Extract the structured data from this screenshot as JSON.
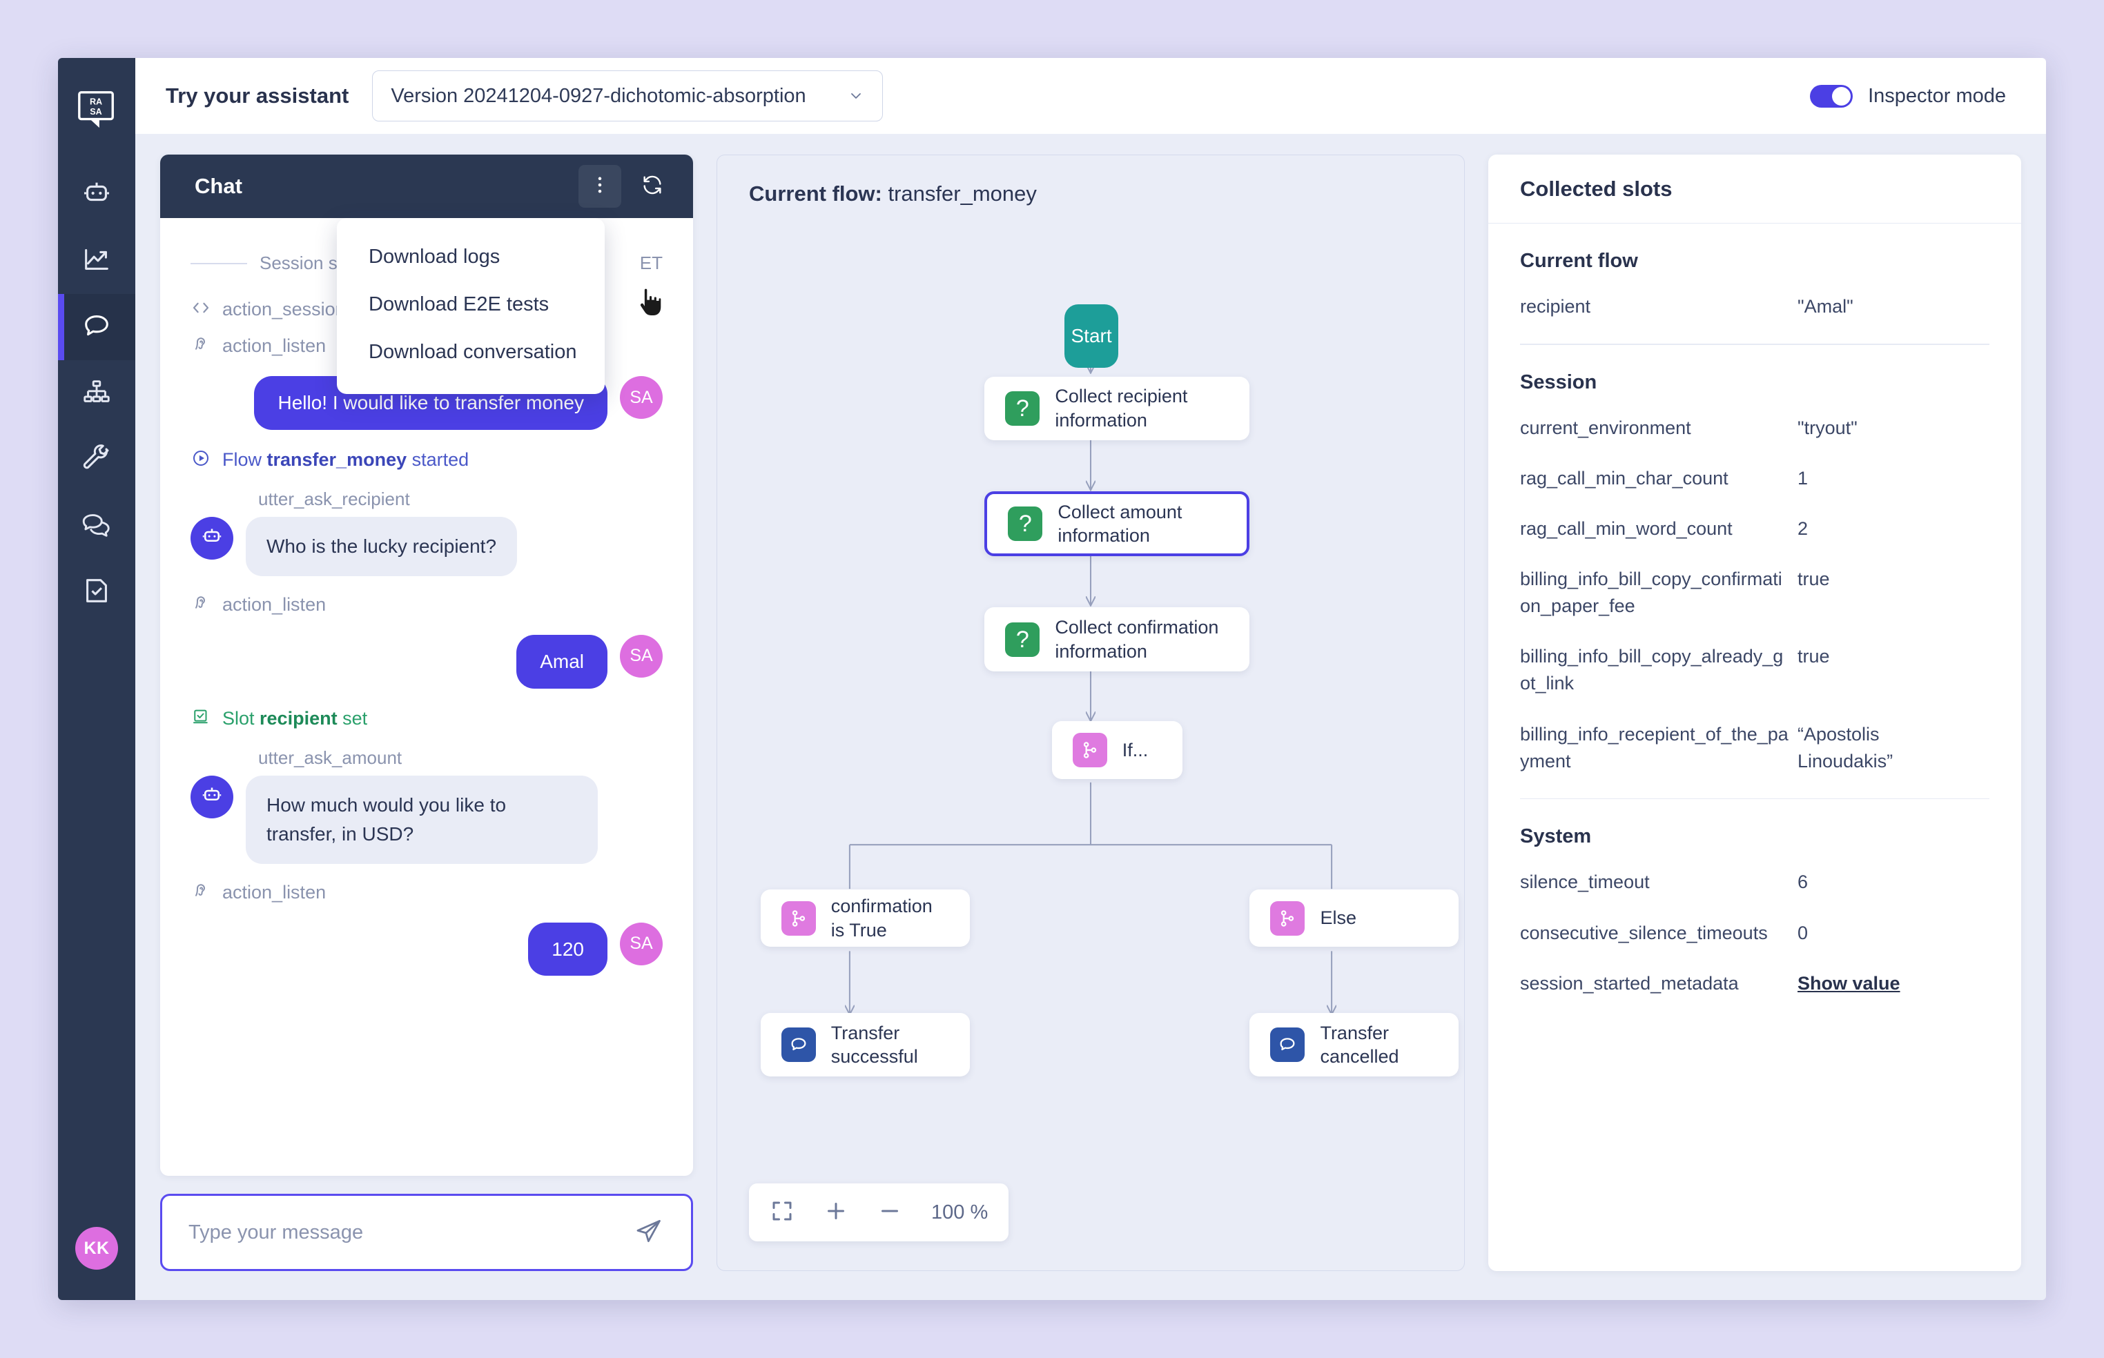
{
  "topbar": {
    "title": "Try your assistant",
    "version_value": "Version 20241204-0927-dichotomic-absorption",
    "inspector_label": "Inspector mode",
    "inspector_on": true,
    "accent": "#4b3fe4"
  },
  "sidebar": {
    "logo": "rasa-logo",
    "avatar_initials": "KK",
    "items": [
      {
        "name": "assistant",
        "icon": "robot-icon",
        "active": false
      },
      {
        "name": "analytics",
        "icon": "chart-line-icon",
        "active": false
      },
      {
        "name": "chat",
        "icon": "speech-bubble-icon",
        "active": true
      },
      {
        "name": "flows",
        "icon": "hierarchy-icon",
        "active": false
      },
      {
        "name": "tools",
        "icon": "wrench-icon",
        "active": false
      },
      {
        "name": "conversations",
        "icon": "double-bubble-icon",
        "active": false
      },
      {
        "name": "tests",
        "icon": "document-check-icon",
        "active": false
      }
    ]
  },
  "chat": {
    "title": "Chat",
    "menu": {
      "items": [
        "Download logs",
        "Download E2E tests",
        "Download conversation"
      ]
    },
    "session_divider": "Session star",
    "session_divider_tail": "ET",
    "events": {
      "action_session_start": "action_session",
      "action_listen": "action_listen",
      "flow_prefix": "Flow ",
      "flow_name": "transfer_money",
      "flow_suffix": " started",
      "slot_prefix": "Slot ",
      "slot_name": "recipient",
      "slot_suffix": " set"
    },
    "messages": {
      "user_hello": "Hello! I would like to transfer money",
      "utter_ask_recipient_label": "utter_ask_recipient",
      "bot_ask_recipient": "Who is the lucky recipient?",
      "user_recipient": "Amal",
      "utter_ask_amount_label": "utter_ask_amount",
      "bot_ask_amount": "How much would you like to transfer, in USD?",
      "user_amount": "120",
      "user_initials": "SA"
    },
    "composer_placeholder": "Type your message",
    "composer_value": ""
  },
  "flow": {
    "title_prefix": "Current flow: ",
    "title_name": "transfer_money",
    "zoom_value": "100 %",
    "nodes": {
      "start": "Start",
      "collect_recipient": "Collect recipient information",
      "collect_amount": "Collect amount information",
      "collect_confirmation": "Collect confirmation information",
      "if": "If...",
      "branch_true": "confirmation is True",
      "branch_else": "Else",
      "leaf_success": "Transfer successful",
      "leaf_cancelled": "Transfer cancelled"
    }
  },
  "slots": {
    "header": "Collected slots",
    "groups": [
      {
        "title": "Current flow",
        "rows": [
          {
            "key": "recipient",
            "value": "\"Amal\""
          }
        ]
      },
      {
        "title": "Session",
        "rows": [
          {
            "key": "current_environment",
            "value": "\"tryout\""
          },
          {
            "key": "rag_call_min_char_count",
            "value": "1"
          },
          {
            "key": "rag_call_min_word_count",
            "value": "2"
          },
          {
            "key": "billing_info_bill_copy_confirmation_paper_fee",
            "value": "true"
          },
          {
            "key": "billing_info_bill_copy_already_got_link",
            "value": "true"
          },
          {
            "key": "billing_info_recepient_of_the_payment",
            "value": "“Apostolis Linoudakis”"
          }
        ]
      },
      {
        "title": "System",
        "rows": [
          {
            "key": "silence_timeout",
            "value": "6"
          },
          {
            "key": "consecutive_silence_timeouts",
            "value": "0"
          },
          {
            "key": "session_started_metadata",
            "value": "Show value",
            "link": true
          }
        ]
      }
    ]
  }
}
